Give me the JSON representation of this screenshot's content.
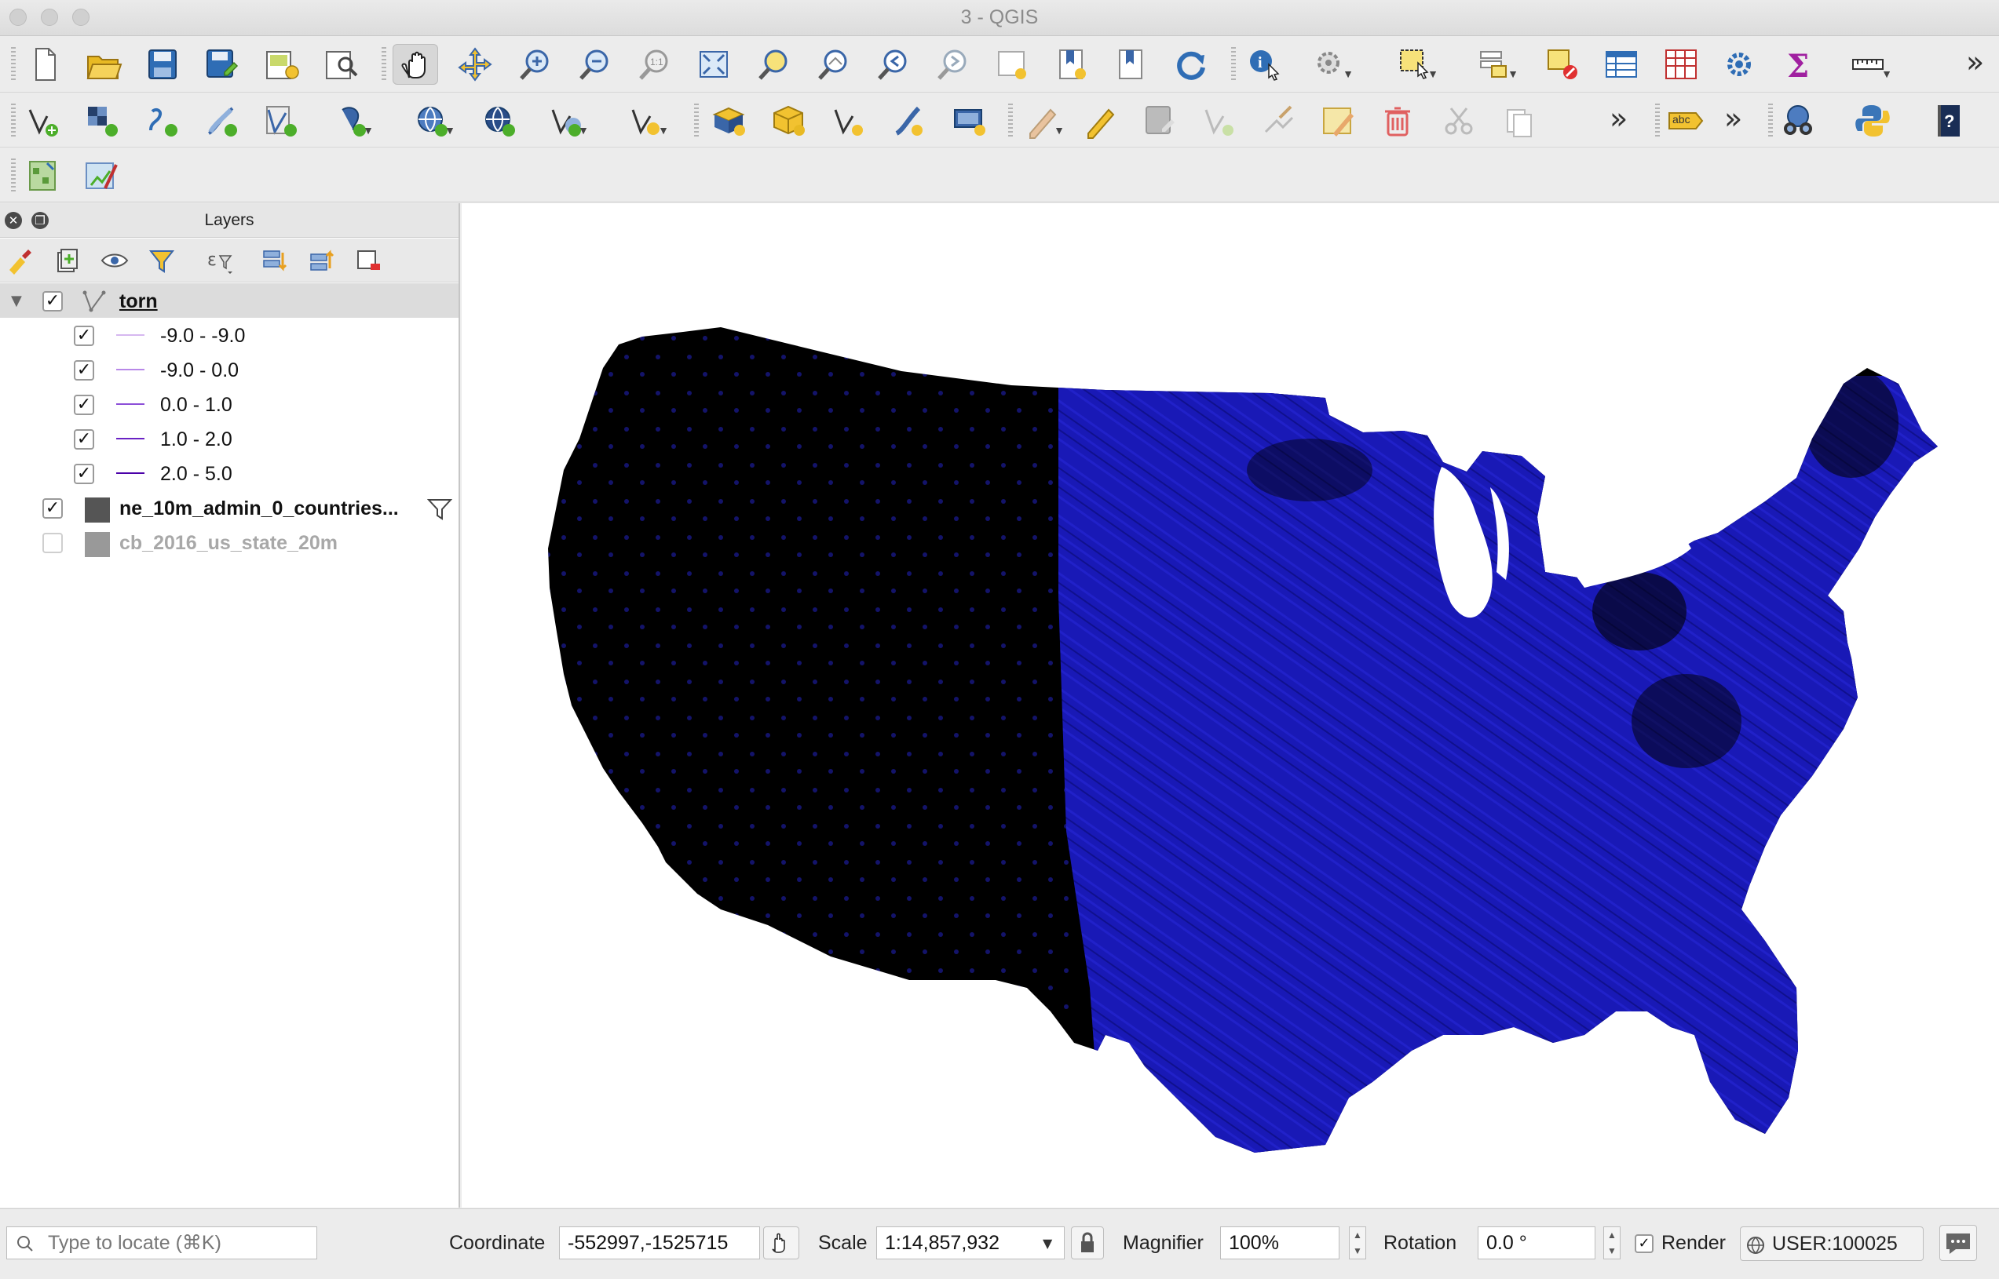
{
  "window": {
    "title": "3 - QGIS"
  },
  "toolbar1": {
    "icons": [
      "new-project-icon",
      "open-project-icon",
      "save-project-icon",
      "save-as-icon",
      "new-print-layout-icon",
      "layout-manager-icon",
      "pan-icon",
      "pan-to-selection-icon",
      "zoom-in-icon",
      "zoom-out-icon",
      "zoom-native-icon",
      "zoom-full-icon",
      "zoom-to-selection-icon",
      "zoom-to-layer-icon",
      "zoom-last-icon",
      "zoom-next-icon",
      "new-map-view-icon",
      "new-bookmark-icon",
      "show-bookmarks-icon",
      "refresh-icon",
      "identify-icon",
      "run-action-icon",
      "select-features-icon",
      "select-by-value-icon",
      "deselect-all-icon",
      "open-attribute-table-icon",
      "statistical-summary-icon",
      "processing-toolbox-icon",
      "field-calculator-icon",
      "measure-icon"
    ]
  },
  "toolbar2": {
    "icons": [
      "add-vector-layer-icon",
      "add-raster-layer-icon",
      "add-delimited-text-icon",
      "add-spatialite-layer-icon",
      "add-virtual-layer-icon",
      "add-postgis-layer-icon",
      "add-wms-layer-icon",
      "add-wfs-layer-icon",
      "add-wcs-layer-icon",
      "add-mesh-layer-icon",
      "new-geopackage-layer-icon",
      "new-shapefile-layer-icon",
      "new-temp-layer-icon",
      "new-virtual-layer-icon",
      "digitize-icon",
      "current-edits-icon",
      "toggle-editing-icon",
      "save-edits-icon",
      "add-feature-icon",
      "vertex-tool-icon",
      "modify-attributes-icon",
      "delete-selected-icon",
      "cut-features-icon",
      "copy-features-icon",
      "label-icon",
      "metasearch-icon",
      "python-console-icon",
      "help-icon"
    ],
    "label_badge": "abc"
  },
  "toolbar3": {
    "icons": [
      "georeferencer-icon",
      "style-editor-icon"
    ]
  },
  "layers_panel": {
    "title": "Layers",
    "tools": [
      "open-styling-icon",
      "add-group-icon",
      "manage-visibility-icon",
      "filter-legend-icon",
      "filter-by-expression-icon",
      "expand-all-icon",
      "collapse-all-icon",
      "remove-layer-icon"
    ],
    "layers": [
      {
        "name": "torn",
        "checked": true,
        "selected": true,
        "geometry": "line",
        "classes": [
          {
            "label": "-9.0 - -9.0",
            "checked": true,
            "color": "#d6b8f0"
          },
          {
            "label": "-9.0 - 0.0",
            "checked": true,
            "color": "#b888e8"
          },
          {
            "label": "0.0 - 1.0",
            "checked": true,
            "color": "#8c4fd8"
          },
          {
            "label": "1.0 - 2.0",
            "checked": true,
            "color": "#6a22c4"
          },
          {
            "label": "2.0 - 5.0",
            "checked": true,
            "color": "#4b00a8"
          }
        ]
      },
      {
        "name": "ne_10m_admin_0_countries...",
        "checked": true,
        "color": "#555555",
        "has_filter": true
      },
      {
        "name": "cb_2016_us_state_20m",
        "checked": false,
        "color": "#999999"
      }
    ]
  },
  "map": {
    "land_color": "#000000",
    "track_color": "#1a1ab8",
    "background": "#ffffff"
  },
  "status": {
    "locator_placeholder": "Type to locate (⌘K)",
    "coordinate_label": "Coordinate",
    "coordinate_value": "-552997,-1525715",
    "scale_label": "Scale",
    "scale_value": "1:14,857,932",
    "magnifier_label": "Magnifier",
    "magnifier_value": "100%",
    "rotation_label": "Rotation",
    "rotation_value": "0.0 °",
    "render_label": "Render",
    "render_checked": true,
    "crs_value": "USER:100025"
  }
}
